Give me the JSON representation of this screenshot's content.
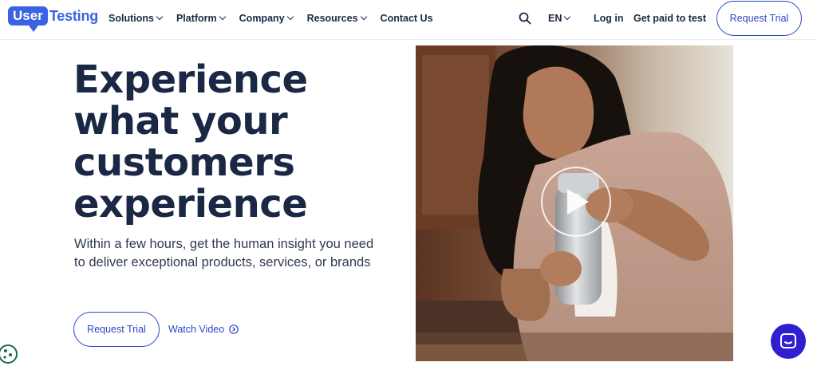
{
  "logo": {
    "part1": "User",
    "part2": "Testing"
  },
  "nav": {
    "items": [
      {
        "label": "Solutions",
        "dropdown": true
      },
      {
        "label": "Platform",
        "dropdown": true
      },
      {
        "label": "Company",
        "dropdown": true
      },
      {
        "label": "Resources",
        "dropdown": true
      },
      {
        "label": "Contact Us",
        "dropdown": false
      }
    ],
    "language": "EN",
    "login": "Log in",
    "get_paid": "Get paid to test",
    "request_trial": "Request Trial"
  },
  "hero": {
    "headline": [
      "Experience",
      "what your",
      "customers",
      "experience"
    ],
    "subtext": "Within a few hours, get the human insight you need to deliver exceptional products, services, or brands",
    "cta_primary": "Request Trial",
    "cta_secondary": "Watch Video"
  },
  "colors": {
    "brand_blue": "#3a63e3",
    "cta_blue": "#2b45c7",
    "heading_navy": "#1b2845",
    "chat_purple": "#2f1fd1"
  },
  "icons": [
    "search-icon",
    "chevron-down-icon",
    "play-icon",
    "play-circle-icon",
    "chat-icon",
    "cookie-icon"
  ]
}
